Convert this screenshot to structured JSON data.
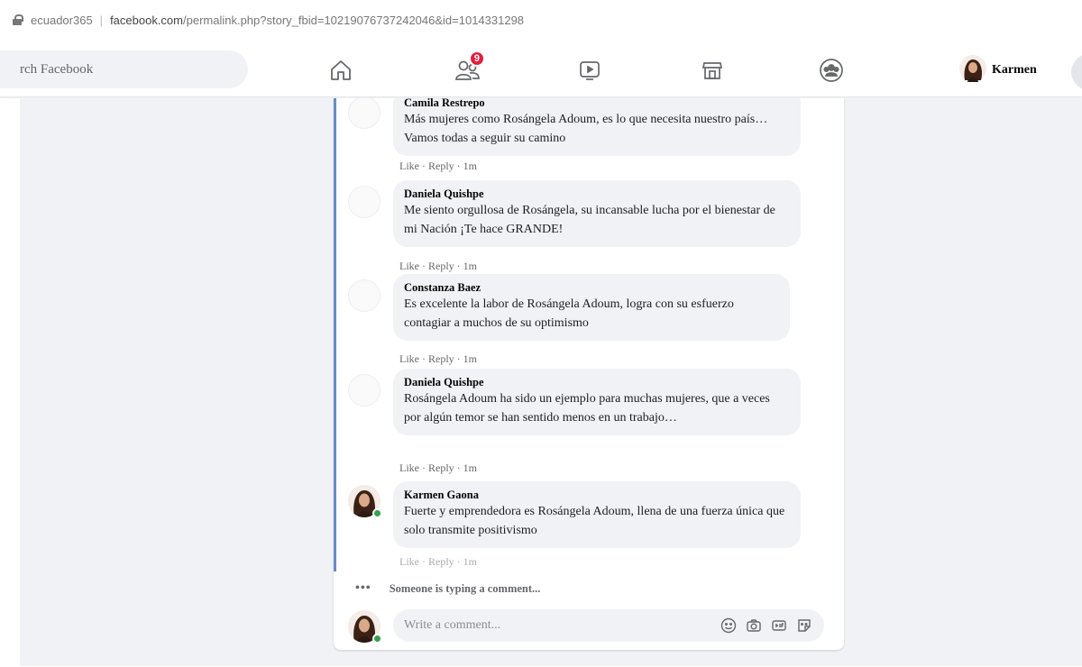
{
  "browser": {
    "site_label": "ecuador365",
    "url_domain": "facebook.com",
    "url_path": "/permalink.php?story_fbid=10219076737242046&id=1014331298"
  },
  "nav": {
    "search_placeholder": "rch Facebook",
    "friends_badge": "9",
    "icons": [
      "home-icon",
      "friends-icon",
      "watch-icon",
      "marketplace-icon",
      "groups-icon"
    ],
    "profile_name": "Karmen"
  },
  "comments": [
    {
      "author": "Camila Restrepo",
      "text": "Más mujeres como Rosángela Adoum, es lo que necesita nuestro país… Vamos todas a seguir su camino",
      "like": "Like",
      "reply": "Reply",
      "time": "1m"
    },
    {
      "author": "Daniela Quishpe",
      "text": "Me siento orgullosa de Rosángela, su incansable lucha por el bienestar de mi Nación ¡Te hace GRANDE!",
      "like": "Like",
      "reply": "Reply",
      "time": "1m"
    },
    {
      "author": "Constanza Baez",
      "text": "Es excelente la labor de Rosángela Adoum, logra con su esfuerzo contagiar a muchos de su optimismo",
      "like": "Like",
      "reply": "Reply",
      "time": "1m"
    },
    {
      "author": "Daniela Quishpe",
      "text": "Rosángela Adoum ha sido un ejemplo para muchas mujeres, que a veces por algún temor se han sentido menos en un trabajo…",
      "like": "Like",
      "reply": "Reply",
      "time": "1m"
    },
    {
      "author": "Karmen Gaona",
      "text": "Fuerte y emprendedora es Rosángela Adoum, llena de una fuerza única que solo transmite positivismo",
      "like": "Like",
      "reply": "Reply",
      "time": "1m"
    }
  ],
  "typing_indicator": "Someone is typing a comment...",
  "composer": {
    "placeholder": "Write a comment..."
  },
  "colors": {
    "badge": "#e41e3f",
    "thread_line": "#6b8cc7",
    "online": "#31a24c"
  }
}
